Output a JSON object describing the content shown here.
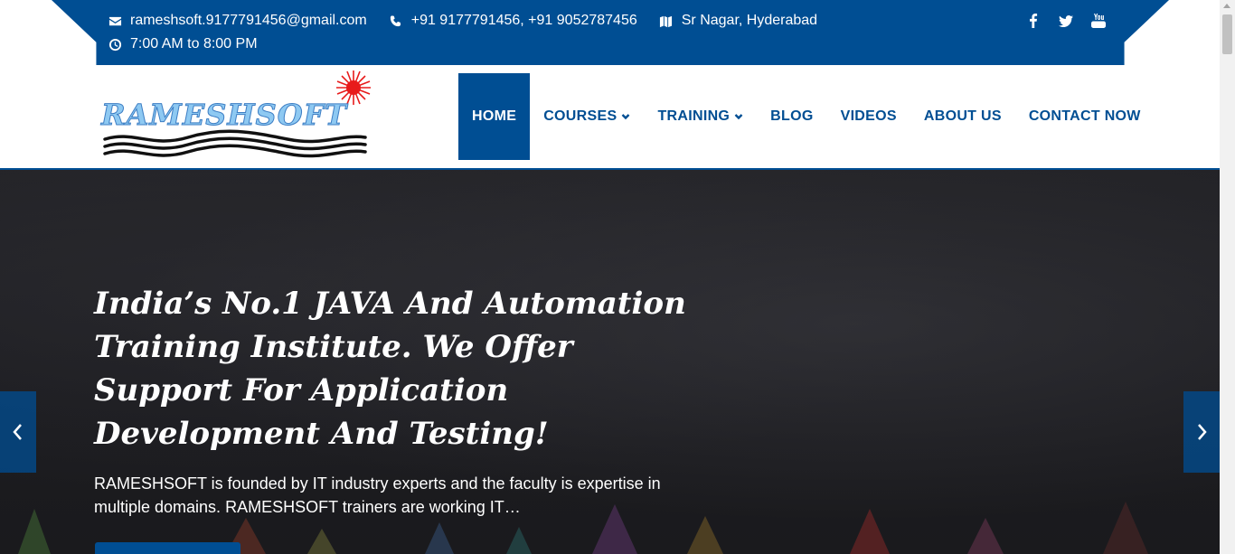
{
  "topbar": {
    "email": "rameshsoft.9177791456@gmail.com",
    "phone": "+91 9177791456, +91 9052787456",
    "location": "Sr Nagar, Hyderabad",
    "hours": "7:00 AM to 8:00 PM",
    "social_icons": [
      "facebook-icon",
      "twitter-icon",
      "youtube-icon"
    ]
  },
  "logo": {
    "text": "RAMESHSOFT"
  },
  "nav": {
    "home": "HOME",
    "courses": "COURSES",
    "training": "TRAINING",
    "blog": "BLOG",
    "videos": "VIDEOS",
    "about": "ABOUT US",
    "contact": "CONTACT NOW"
  },
  "hero": {
    "title": "India’s No.1 JAVA And Automation Training Institute. We Offer Support For Application Development And Testing!",
    "description": "RAMESHSOFT is founded by IT industry experts and the faculty is expertise in multiple domains. RAMESHSOFT trainers are working IT…"
  },
  "colors": {
    "brand": "#004e93",
    "hero_bg": "#1e1e22",
    "logo_text": "#8ec9f2",
    "logo_sun": "#e81b1b"
  }
}
